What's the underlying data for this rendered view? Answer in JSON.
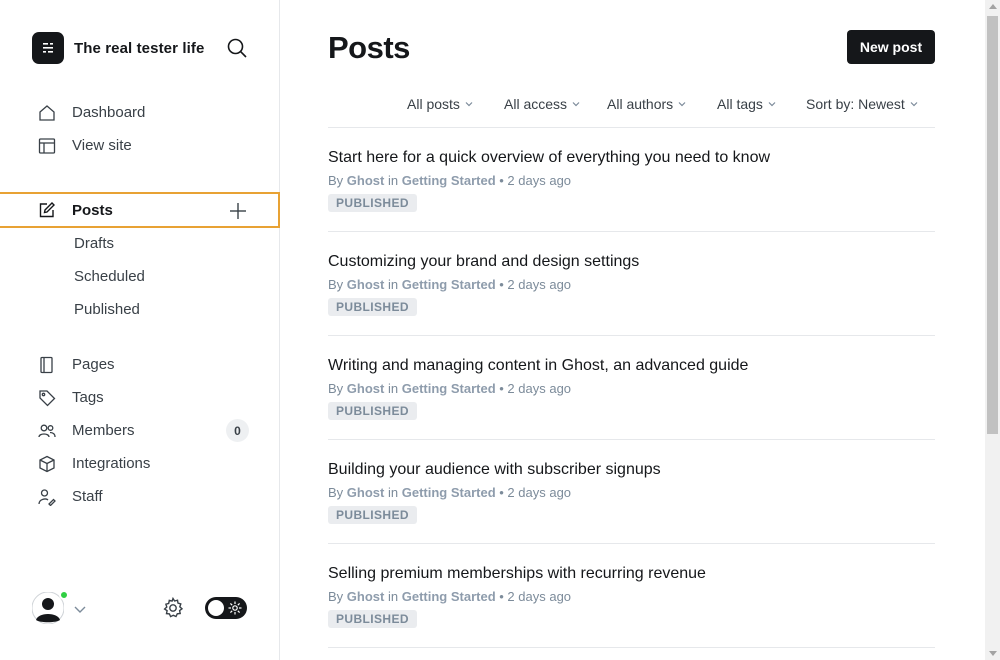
{
  "brand": {
    "title": "The real tester life",
    "icon": "ghost-logo-icon"
  },
  "sidebar": {
    "main": [
      {
        "label": "Dashboard",
        "icon": "home-icon"
      },
      {
        "label": "View site",
        "icon": "layout-icon"
      }
    ],
    "posts": {
      "label": "Posts",
      "icon": "edit-icon",
      "sub": [
        "Drafts",
        "Scheduled",
        "Published"
      ]
    },
    "secondary": [
      {
        "label": "Pages",
        "icon": "page-icon"
      },
      {
        "label": "Tags",
        "icon": "tag-icon"
      },
      {
        "label": "Members",
        "icon": "members-icon",
        "count": "0"
      },
      {
        "label": "Integrations",
        "icon": "box-icon"
      },
      {
        "label": "Staff",
        "icon": "staff-icon"
      }
    ]
  },
  "main": {
    "title": "Posts",
    "new_post_label": "New post",
    "filters": [
      "All posts",
      "All access",
      "All authors",
      "All tags",
      "Sort by: Newest"
    ],
    "posts": [
      {
        "title": "Start here for a quick overview of everything you need to know",
        "by": "By",
        "author": "Ghost",
        "in": "in",
        "tag": "Getting Started",
        "time": "• 2 days ago",
        "status": "PUBLISHED"
      },
      {
        "title": "Customizing your brand and design settings",
        "by": "By",
        "author": "Ghost",
        "in": "in",
        "tag": "Getting Started",
        "time": "• 2 days ago",
        "status": "PUBLISHED"
      },
      {
        "title": "Writing and managing content in Ghost, an advanced guide",
        "by": "By",
        "author": "Ghost",
        "in": "in",
        "tag": "Getting Started",
        "time": "• 2 days ago",
        "status": "PUBLISHED"
      },
      {
        "title": "Building your audience with subscriber signups",
        "by": "By",
        "author": "Ghost",
        "in": "in",
        "tag": "Getting Started",
        "time": "• 2 days ago",
        "status": "PUBLISHED"
      },
      {
        "title": "Selling premium memberships with recurring revenue",
        "by": "By",
        "author": "Ghost",
        "in": "in",
        "tag": "Getting Started",
        "time": "• 2 days ago",
        "status": "PUBLISHED"
      }
    ]
  },
  "colors": {
    "accent_outline": "#e8a234",
    "online": "#30cf43",
    "dark": "#15171a"
  }
}
